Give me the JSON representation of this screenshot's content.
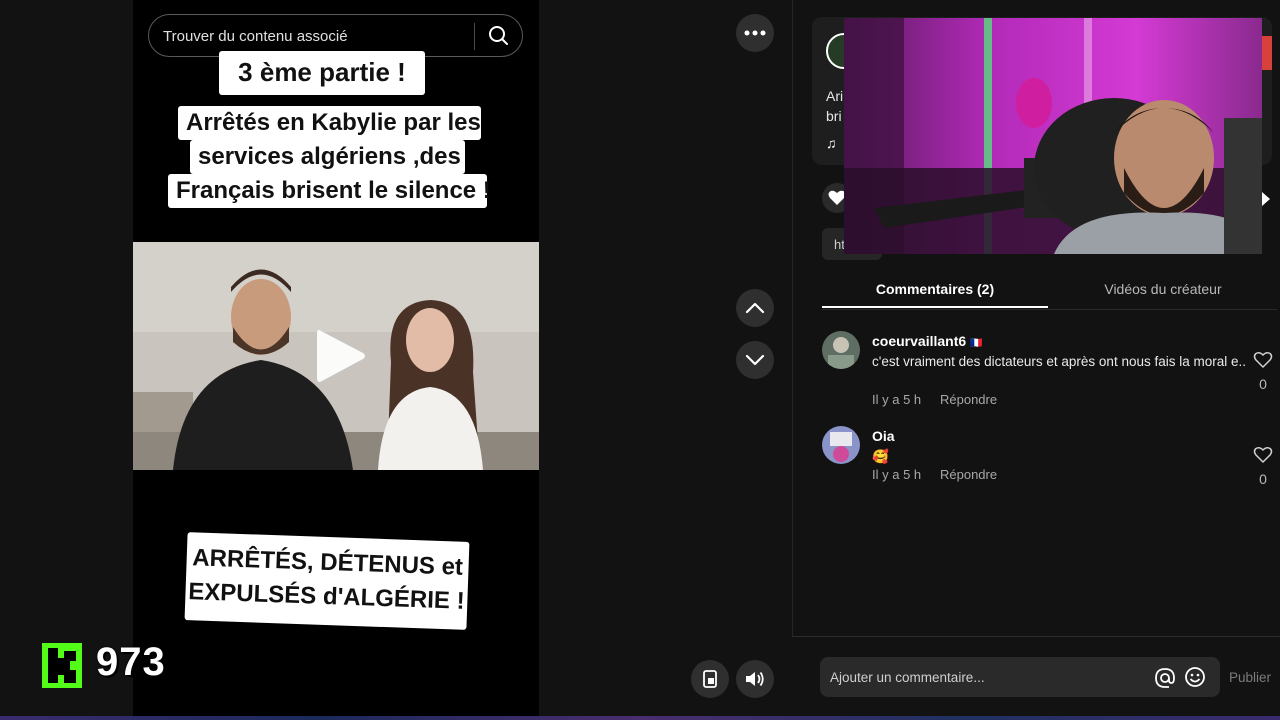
{
  "search": {
    "placeholder": "Trouver du contenu associé"
  },
  "video": {
    "caption_top": "3 ème partie !",
    "caption_lines": [
      "Arrêtés en Kabylie par les",
      "services algériens ,des",
      "Français brisent le silence !"
    ],
    "caption_bottom_lines": [
      "ARRÊTÉS, DÉTENUS et",
      "EXPULSÉS d'ALGÉRIE !"
    ]
  },
  "stream": {
    "viewer_count": "973"
  },
  "creator_card": {
    "partial_title_1": "Ari",
    "partial_title_2": "bri",
    "partial_link": "ht",
    "music_icon": "music-note-icon"
  },
  "tabs": {
    "comments_label": "Commentaires (2)",
    "videos_label": "Vidéos du créateur"
  },
  "comments": [
    {
      "username": "coeurvaillant6",
      "flag": "🇫🇷",
      "text": "c'est vraiment des dictateurs et après ont nous fais la moral e..",
      "time": "Il y a 5 h",
      "reply_label": "Répondre",
      "likes": "0"
    },
    {
      "username": "Oia",
      "flag": "",
      "text": "🥰",
      "time": "Il y a 5 h",
      "reply_label": "Répondre",
      "likes": "0"
    }
  ],
  "comment_box": {
    "placeholder": "Ajouter un commentaire...",
    "publish_label": "Publier"
  },
  "colors": {
    "kick_green": "#53fc18",
    "background": "#121212",
    "card": "#1e1e1e"
  }
}
